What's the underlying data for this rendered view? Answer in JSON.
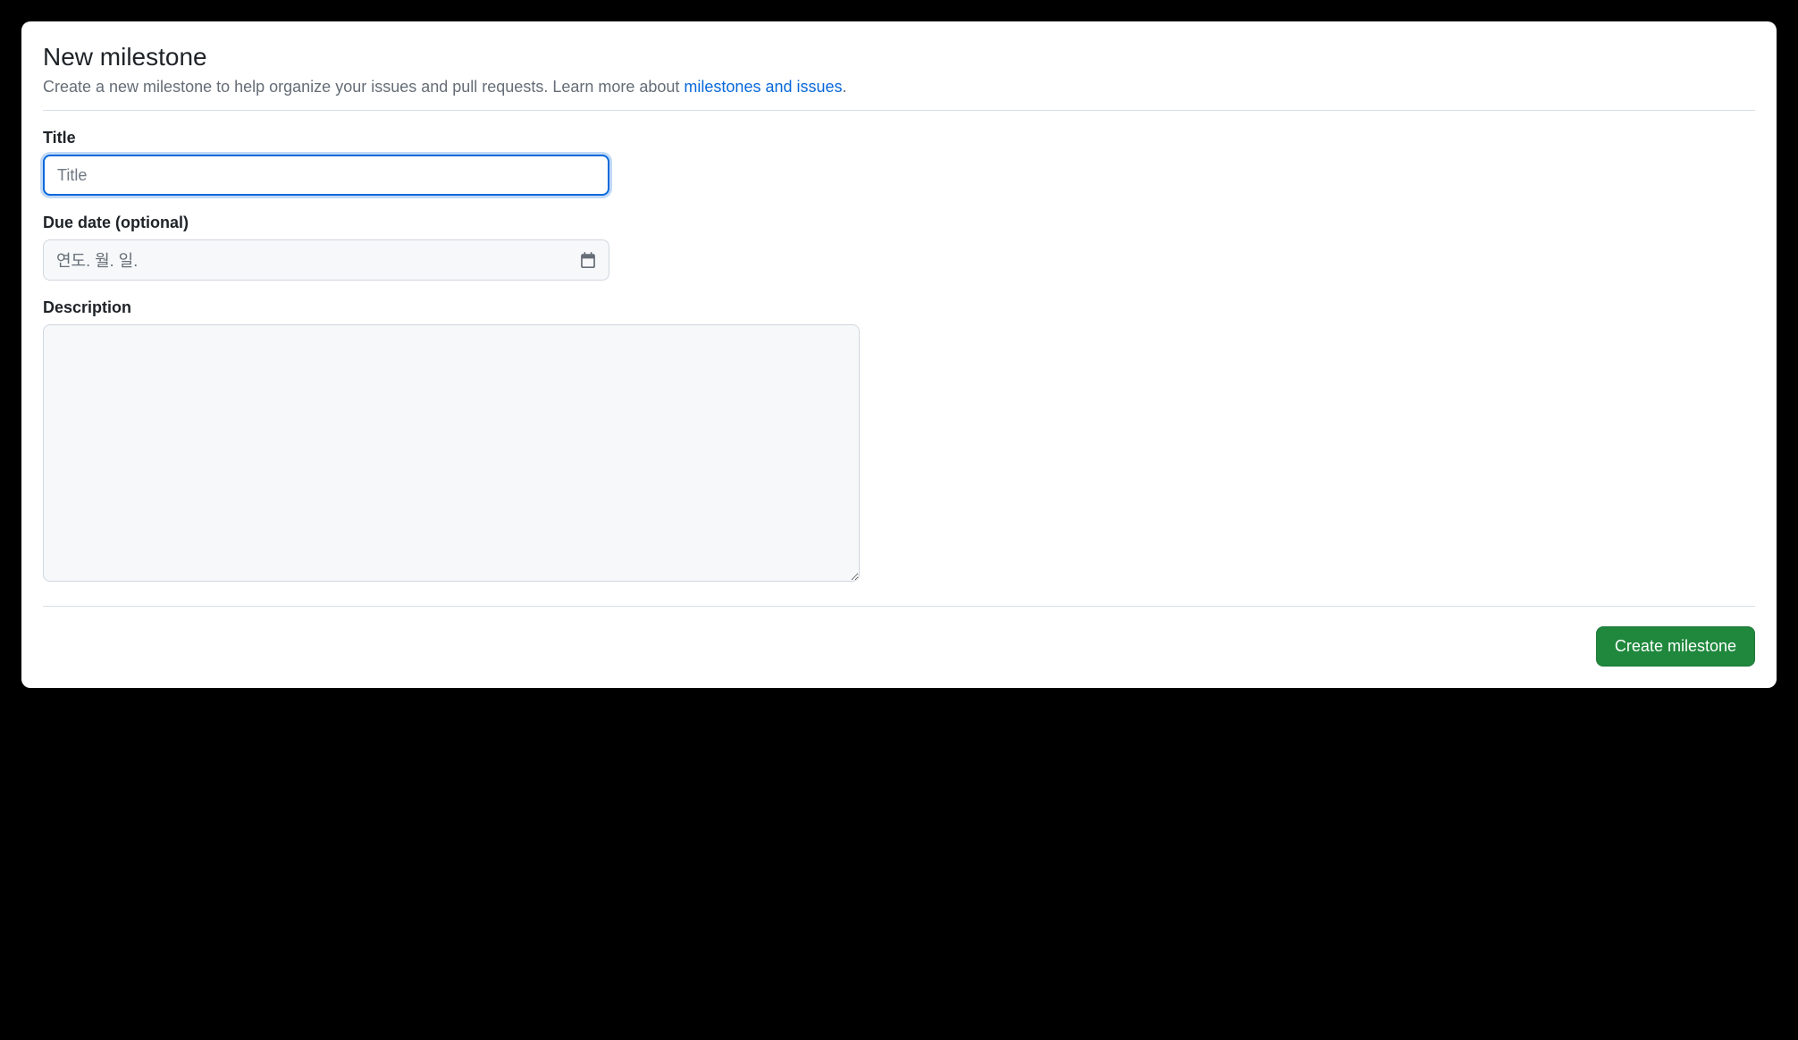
{
  "header": {
    "title": "New milestone",
    "subtitle_prefix": "Create a new milestone to help organize your issues and pull requests. Learn more about ",
    "subtitle_link": "milestones and issues",
    "subtitle_suffix": "."
  },
  "form": {
    "title": {
      "label": "Title",
      "placeholder": "Title",
      "value": ""
    },
    "due_date": {
      "label": "Due date (optional)",
      "placeholder": "연도. 월. 일.",
      "value": ""
    },
    "description": {
      "label": "Description",
      "value": ""
    }
  },
  "actions": {
    "create_label": "Create milestone"
  }
}
